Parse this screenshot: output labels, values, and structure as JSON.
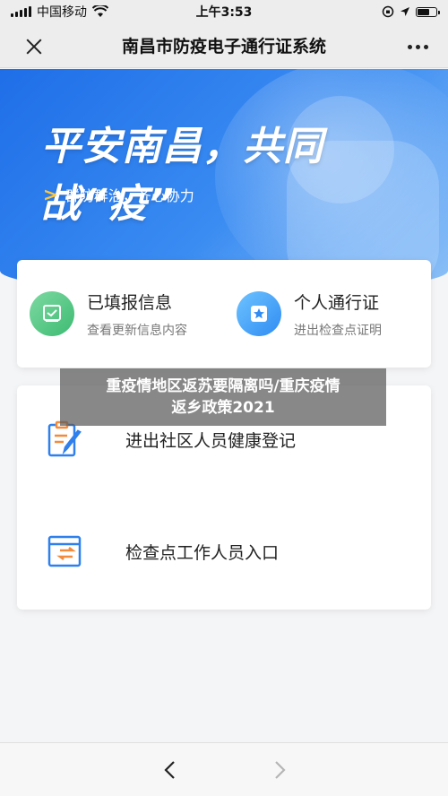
{
  "status_bar": {
    "carrier": "中国移动",
    "time": "上午3:53"
  },
  "nav": {
    "title": "南昌市防疫电子通行证系统",
    "close_icon": "close-icon",
    "more_icon": "more-icon"
  },
  "banner": {
    "title": "平安南昌，共同战“疫”",
    "subtitle": "群防群治，齐心协力"
  },
  "quick_actions": [
    {
      "title": "已填报信息",
      "subtitle": "查看更新信息内容",
      "icon": "checklist-icon",
      "color": "#3dbb72"
    },
    {
      "title": "个人通行证",
      "subtitle": "进出检查点证明",
      "icon": "star-badge-icon",
      "color": "#2f8cf3"
    }
  ],
  "menu_items": [
    {
      "label": "进出社区人员健康登记",
      "icon": "form-edit-icon"
    },
    {
      "label": "检查点工作人员入口",
      "icon": "checkpoint-entry-icon"
    }
  ],
  "overlay": {
    "line1": "重疫情地区返苏要隔离吗/重庆疫情",
    "line2": "返乡政策2021"
  },
  "toolbar": {
    "back_icon": "back-arrow-icon",
    "forward_icon": "forward-arrow-icon"
  },
  "colors": {
    "brand_blue": "#2f80ed",
    "accent_orange": "#f28b3c",
    "accent_yellow": "#ffc73a"
  }
}
